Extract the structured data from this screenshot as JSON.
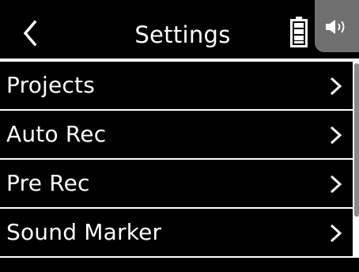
{
  "header": {
    "title": "Settings"
  },
  "icons": {
    "back": "chevron-left-icon",
    "battery": "battery-icon",
    "speaker": "speaker-icon",
    "row_chevron": "chevron-right-icon"
  },
  "menu": {
    "items": [
      {
        "label": "Projects"
      },
      {
        "label": "Auto Rec"
      },
      {
        "label": "Pre Rec"
      },
      {
        "label": "Sound Marker"
      }
    ]
  },
  "colors": {
    "background": "#000000",
    "divider": "#ffffff",
    "text": "#ffffff",
    "speaker_tab": "#6f6f6f",
    "scrollbar": "#8a8a8a"
  }
}
